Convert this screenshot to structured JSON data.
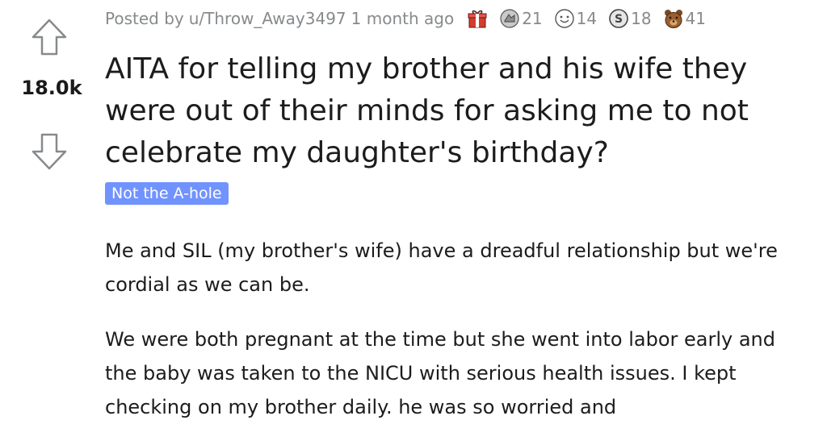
{
  "post": {
    "score": "18.0k",
    "posted_by_prefix": "Posted by",
    "author": "u/Throw_Away3497",
    "time": "1 month ago",
    "awards": [
      {
        "icon": "gift-award-icon",
        "count": ""
      },
      {
        "icon": "silver-award-icon",
        "count": "21"
      },
      {
        "icon": "wholesome-award-icon",
        "count": "14"
      },
      {
        "icon": "coin-award-icon",
        "count": "18"
      },
      {
        "icon": "bear-award-icon",
        "count": "41"
      }
    ],
    "title": "AITA for telling my brother and his wife they were out of their minds for asking me to not celebrate my daughter's birthday?",
    "flair": "Not the A-hole",
    "paragraphs": [
      "Me and SIL (my brother's wife) have a dreadful relationship but we're cordial as we can be.",
      "We were both pregnant at the time but she went into labor early and the baby was taken to the NICU with serious health issues. I kept checking on my brother daily. he was so worried and"
    ]
  },
  "colors": {
    "flair_bg": "#7193ff",
    "meta_text": "#878a8c",
    "title_text": "#1c1c1c",
    "vote_arrow": "#878a8c"
  }
}
